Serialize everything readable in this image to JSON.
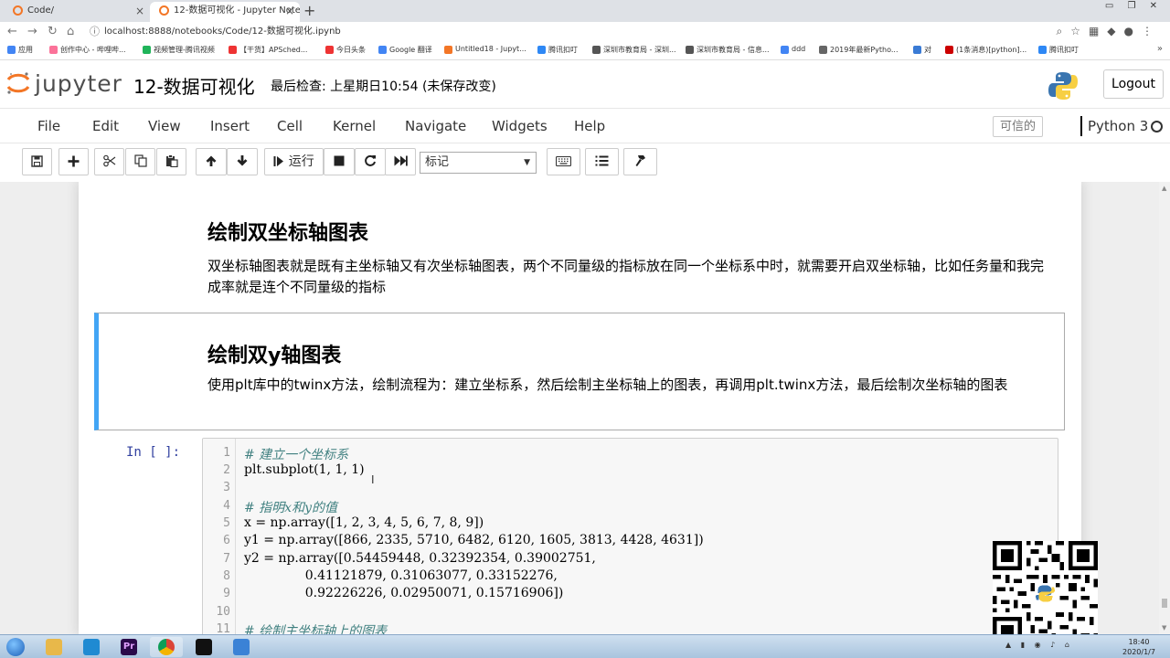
{
  "browser": {
    "tabs": [
      {
        "label": "Code/"
      },
      {
        "label": "12-数据可视化 - Jupyter Notel"
      }
    ],
    "url": "localhost:8888/notebooks/Code/12-数据可视化.ipynb",
    "bookmarks": [
      {
        "label": "应用",
        "color": "#4285f4"
      },
      {
        "label": "创作中心 - 哔哩哔...",
        "color": "#fb7299"
      },
      {
        "label": "视频管理-腾讯视频",
        "color": "#20b45a"
      },
      {
        "label": "【干货】APSched...",
        "color": "#e33"
      },
      {
        "label": "今日头条",
        "color": "#e33"
      },
      {
        "label": "Google 翻译",
        "color": "#4285f4"
      },
      {
        "label": "Untitled18 - Jupyt...",
        "color": "#f37626"
      },
      {
        "label": "腾讯扣叮",
        "color": "#2e88f5"
      },
      {
        "label": "深圳市教育局 - 深圳...",
        "color": "#555"
      },
      {
        "label": "深圳市教育局 - 信息...",
        "color": "#555"
      },
      {
        "label": "ddd",
        "color": "#4285f4"
      },
      {
        "label": "2019年最新Pytho...",
        "color": "#666"
      },
      {
        "label": "对",
        "color": "#3a7bd5"
      },
      {
        "label": "(1条消息)[python]...",
        "color": "#c00"
      },
      {
        "label": "腾讯扣叮",
        "color": "#2e88f5"
      }
    ]
  },
  "jupyter": {
    "logo_text": "jupyter",
    "notebook_name": "12-数据可视化",
    "checkpoint": "最后检查: 上星期日10:54  (未保存改变)",
    "logout": "Logout",
    "menus": [
      "File",
      "Edit",
      "View",
      "Insert",
      "Cell",
      "Kernel",
      "Navigate",
      "Widgets",
      "Help"
    ],
    "trusted": "可信的",
    "kernel": "Python 3"
  },
  "toolbar": {
    "run_label": "运行",
    "cell_type": "标记",
    "icons": [
      "save-icon",
      "plus-icon",
      "cut-icon",
      "copy-icon",
      "paste-icon",
      "arrow-up-icon",
      "arrow-down-icon",
      "run-icon",
      "stop-icon",
      "restart-icon",
      "fast-forward-icon",
      "keyboard-icon",
      "list-icon",
      "command-icon"
    ]
  },
  "cells": {
    "md1": {
      "heading": "绘制双坐标轴图表",
      "text": "双坐标轴图表就是既有主坐标轴又有次坐标轴图表，两个不同量级的指标放在同一个坐标系中时，就需要开启双坐标轴，比如任务量和我完成率就是连个不同量级的指标"
    },
    "md2": {
      "heading": "绘制双y轴图表",
      "text": "使用plt库中的twinx方法，绘制流程为：建立坐标系，然后绘制主坐标轴上的图表，再调用plt.twinx方法，最后绘制次坐标轴的图表"
    },
    "code": {
      "prompt": "In  [  ]:",
      "lines": [
        {
          "n": "1",
          "text": "# 建立一个坐标系",
          "comment": true
        },
        {
          "n": "2",
          "text": "plt.subplot(1, 1, 1)",
          "comment": false
        },
        {
          "n": "3",
          "text": "",
          "comment": false
        },
        {
          "n": "4",
          "text": "# 指明x和y的值",
          "comment": true
        },
        {
          "n": "5",
          "text": "x = np.array([1, 2, 3, 4, 5, 6, 7, 8, 9])",
          "comment": false
        },
        {
          "n": "6",
          "text": "y1 = np.array([866, 2335, 5710, 6482, 6120, 1605, 3813, 4428, 4631])",
          "comment": false
        },
        {
          "n": "7",
          "text": "y2 = np.array([0.54459448, 0.32392354, 0.39002751,",
          "comment": false
        },
        {
          "n": "8",
          "text": "               0.41121879, 0.31063077, 0.33152276,",
          "comment": false
        },
        {
          "n": "9",
          "text": "               0.92226226, 0.02950071, 0.15716906])",
          "comment": false
        },
        {
          "n": "10",
          "text": "",
          "comment": false
        },
        {
          "n": "11",
          "text": "# 绘制主坐标轴上的图表",
          "comment": true
        }
      ]
    }
  },
  "taskbar": {
    "apps": [
      {
        "name": "start-icon",
        "color": "#2d7fd3"
      },
      {
        "name": "explorer-icon",
        "color": "#e8b84a"
      },
      {
        "name": "vscode-icon",
        "color": "#1f8ad2"
      },
      {
        "name": "premiere-icon",
        "color": "#2a0a4a"
      },
      {
        "name": "chrome-icon",
        "color": "#db4437"
      },
      {
        "name": "terminal-icon",
        "color": "#111111"
      },
      {
        "name": "recorder-icon",
        "color": "#3b82d6"
      }
    ],
    "time": "18:40",
    "date": "2020/1/7"
  }
}
